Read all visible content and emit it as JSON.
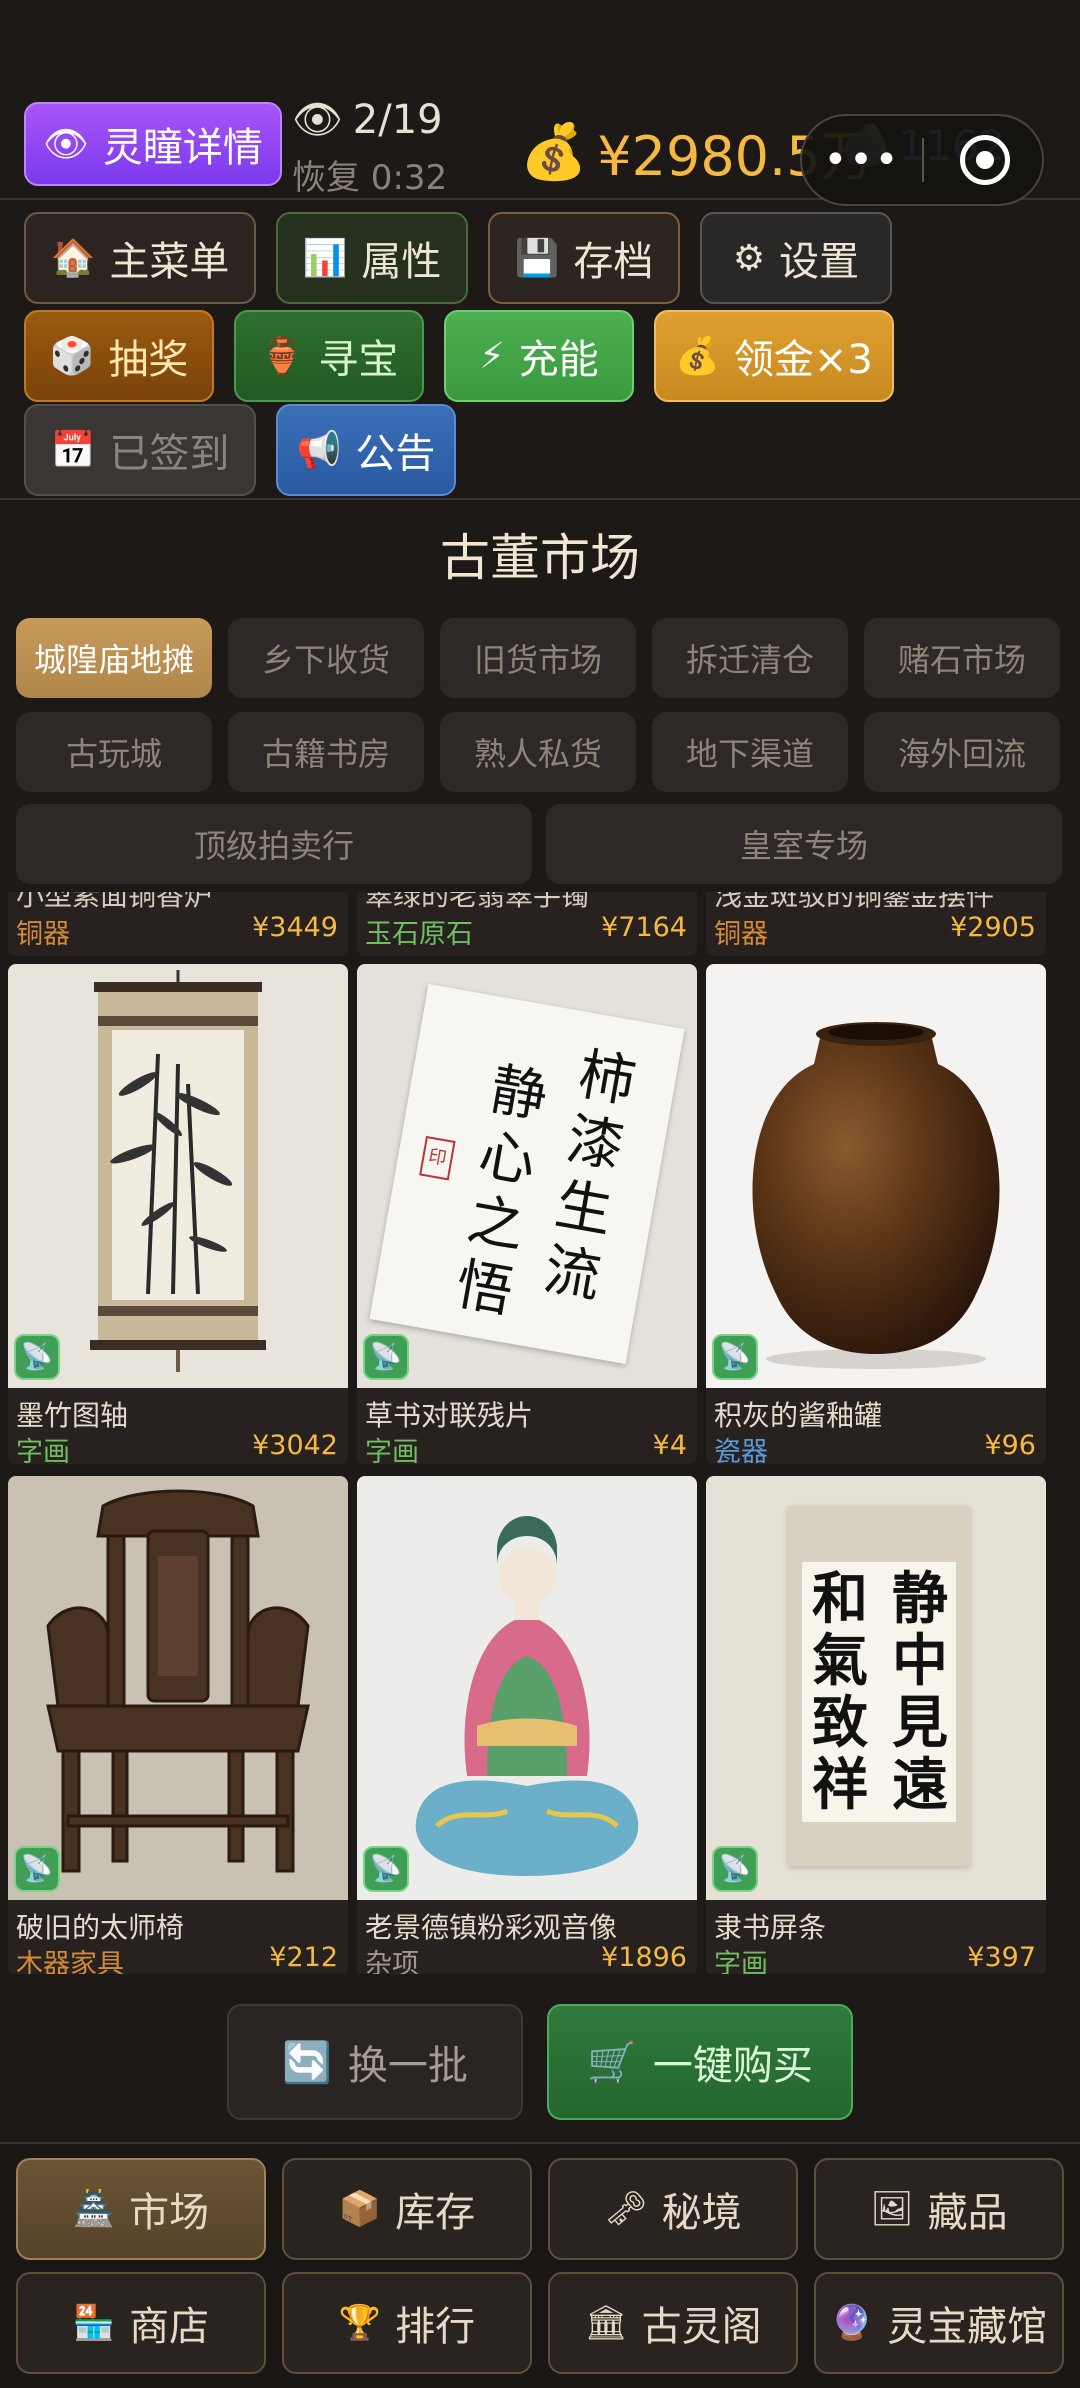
{
  "header": {
    "eye_icon": "eye-icon",
    "eye_label": "灵瞳详情",
    "stamina_icon": "eye-icon",
    "stamina": "2/19",
    "recover": "恢复 0:32",
    "money_icon": "money-bag-icon",
    "money": "¥2980.5万",
    "gem_icon": "gem-icon",
    "gem": "1162",
    "capsule_dots": "•••"
  },
  "toolbar": {
    "row1": [
      {
        "icon": "🏠",
        "label": "主菜单"
      },
      {
        "icon": "📊",
        "label": "属性"
      },
      {
        "icon": "💾",
        "label": "存档"
      },
      {
        "icon": "⚙",
        "label": "设置"
      }
    ],
    "row2": [
      {
        "icon": "🎲",
        "label": "抽奖"
      },
      {
        "icon": "🏺",
        "label": "寻宝"
      },
      {
        "icon": "⚡",
        "label": "充能"
      },
      {
        "icon": "💰",
        "label": "领金×3"
      }
    ],
    "row3": [
      {
        "icon": "📅",
        "label": "已签到"
      },
      {
        "icon": "📢",
        "label": "公告"
      }
    ]
  },
  "market": {
    "title": "古董市场",
    "tabs": [
      "城隍庙地摊",
      "乡下收货",
      "旧货市场",
      "拆迁清仓",
      "赌石市场",
      "古玩城",
      "古籍书房",
      "熟人私货",
      "地下渠道",
      "海外回流"
    ],
    "wide_tabs": [
      "顶级拍卖行",
      "皇室专场"
    ],
    "active_tab": "城隍庙地摊"
  },
  "partial_items": [
    {
      "name": "小型素面铜香炉",
      "category": "铜器",
      "price": "¥3449"
    },
    {
      "name": "翠绿的老翡翠手镯",
      "category": "玉石原石",
      "price": "¥7164"
    },
    {
      "name": "浅金斑驳的铜鎏金摆件",
      "category": "铜器",
      "price": "¥2905"
    }
  ],
  "items": [
    {
      "name": "墨竹图轴",
      "category": "字画",
      "price": "¥3042"
    },
    {
      "name": "草书对联残片",
      "category": "字画",
      "price": "¥4"
    },
    {
      "name": "积灰的酱釉罐",
      "category": "瓷器",
      "price": "¥96"
    },
    {
      "name": "破旧的太师椅",
      "category": "木器家具",
      "price": "¥212"
    },
    {
      "name": "老景德镇粉彩观音像",
      "category": "杂项",
      "price": "¥1896"
    },
    {
      "name": "隶书屏条",
      "category": "字画",
      "price": "¥397"
    }
  ],
  "calligraphy": {
    "cursive_left": "静心之悟",
    "cursive_right": "柿漆生流",
    "seal": "印",
    "clerical_col1": "静中見遠",
    "clerical_col2": "和氣致祥"
  },
  "actions": {
    "refresh_icon": "🔄",
    "refresh_label": "换一批",
    "buy_icon": "🛒",
    "buy_label": "一键购买"
  },
  "nav": [
    {
      "icon": "🏯",
      "label": "市场"
    },
    {
      "icon": "📦",
      "label": "库存"
    },
    {
      "icon": "🗝",
      "label": "秘境"
    },
    {
      "icon": "🖼",
      "label": "藏品"
    },
    {
      "icon": "🏪",
      "label": "商店"
    },
    {
      "icon": "🏆",
      "label": "排行"
    },
    {
      "icon": "🏛",
      "label": "古灵阁"
    },
    {
      "icon": "🔮",
      "label": "灵宝藏馆"
    }
  ],
  "colors": {
    "background": "#1d1917",
    "price": "#f5b942",
    "accent_purple": "#7c3aed",
    "active_tab": "#c89a5a"
  }
}
